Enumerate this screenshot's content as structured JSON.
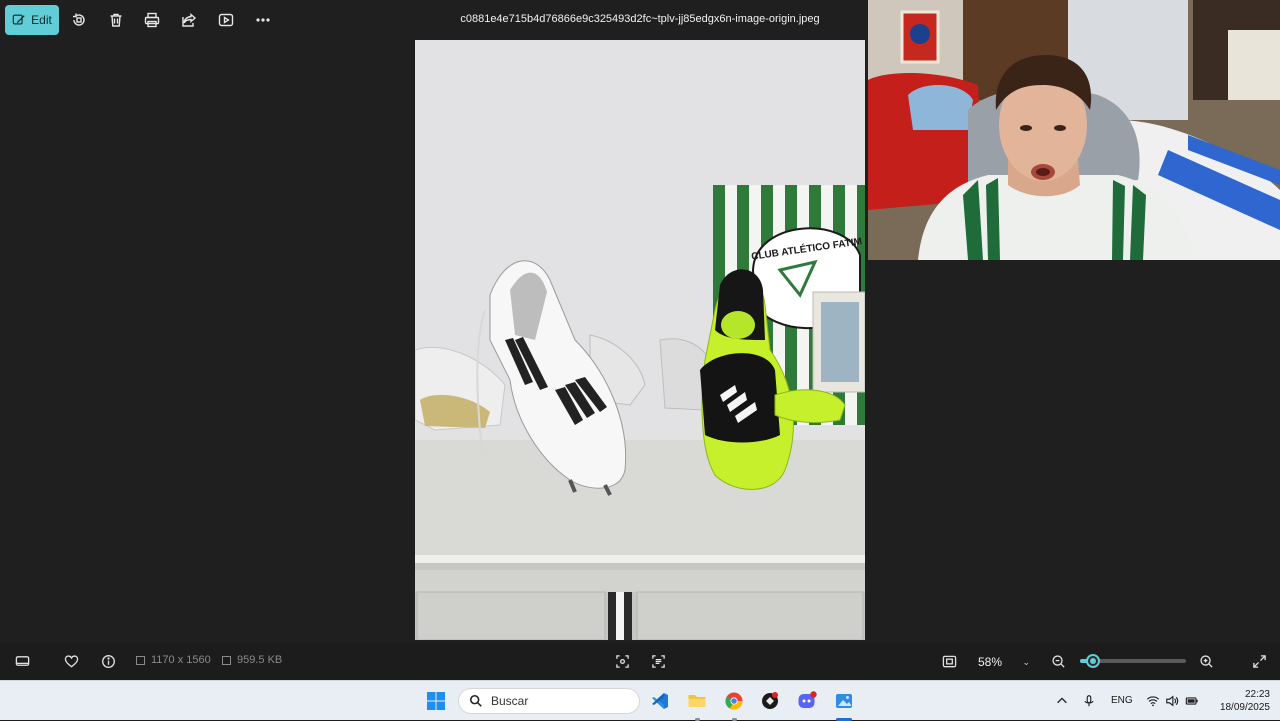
{
  "toolbar": {
    "edit_label": "Edit",
    "icons": [
      "edit-icon",
      "rotate-icon",
      "delete-icon",
      "print-icon",
      "share-icon",
      "slideshow-icon",
      "more-icon"
    ]
  },
  "image": {
    "filename": "c0881e4e715b4d76866e9c325493d2fc~tplv-jj85edgx6n-image-origin.jpeg",
    "dimensions": "1170 x 1560",
    "file_size": "959.5 KB",
    "banner_text": "CLUB ATLÉTICO FATIM"
  },
  "zoom": {
    "value": "58%",
    "level": 0.12
  },
  "taskbar": {
    "search_placeholder": "Buscar",
    "language": "ENG",
    "time": "22:23",
    "date": "18/09/2025",
    "apps": [
      "windows-start",
      "vscode",
      "file-explorer",
      "chrome",
      "app-dark",
      "discord",
      "photos"
    ]
  },
  "colors": {
    "accent": "#60cdd7",
    "app_bg": "#1f1f1f",
    "taskbar_bg": "#e9eef4"
  }
}
